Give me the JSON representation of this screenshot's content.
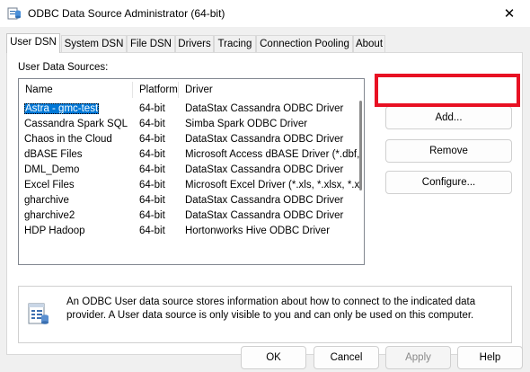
{
  "window": {
    "title": "ODBC Data Source Administrator (64-bit)",
    "close_glyph": "✕"
  },
  "tabs": [
    {
      "label": "User DSN",
      "active": true
    },
    {
      "label": "System DSN"
    },
    {
      "label": "File DSN"
    },
    {
      "label": "Drivers"
    },
    {
      "label": "Tracing"
    },
    {
      "label": "Connection Pooling"
    },
    {
      "label": "About"
    }
  ],
  "panel": {
    "section_label": "User Data Sources:"
  },
  "list": {
    "columns": {
      "name": "Name",
      "platform": "Platform",
      "driver": "Driver"
    },
    "rows": [
      {
        "name": "Astra - gmc-test",
        "platform": "64-bit",
        "driver": "DataStax Cassandra ODBC Driver",
        "selected": true
      },
      {
        "name": "Cassandra Spark SQL",
        "platform": "64-bit",
        "driver": "Simba Spark ODBC Driver"
      },
      {
        "name": "Chaos in the Cloud",
        "platform": "64-bit",
        "driver": "DataStax Cassandra ODBC Driver"
      },
      {
        "name": "dBASE Files",
        "platform": "64-bit",
        "driver": "Microsoft Access dBASE Driver (*.dbf, *.n"
      },
      {
        "name": "DML_Demo",
        "platform": "64-bit",
        "driver": "DataStax Cassandra ODBC Driver"
      },
      {
        "name": "Excel Files",
        "platform": "64-bit",
        "driver": "Microsoft Excel Driver (*.xls, *.xlsx, *.xlsm,"
      },
      {
        "name": "gharchive",
        "platform": "64-bit",
        "driver": "DataStax Cassandra ODBC Driver"
      },
      {
        "name": "gharchive2",
        "platform": "64-bit",
        "driver": "DataStax Cassandra ODBC Driver"
      },
      {
        "name": "HDP Hadoop",
        "platform": "64-bit",
        "driver": "Hortonworks Hive ODBC Driver"
      }
    ]
  },
  "side_buttons": {
    "add": "Add...",
    "remove": "Remove",
    "configure": "Configure..."
  },
  "highlight_color": "#e81123",
  "info": {
    "text": "An ODBC User data source stores information about how to connect to the indicated data provider.   A User data source is only visible to you and can only be used on this computer."
  },
  "footer": {
    "ok": "OK",
    "cancel": "Cancel",
    "apply": "Apply",
    "help": "Help"
  }
}
